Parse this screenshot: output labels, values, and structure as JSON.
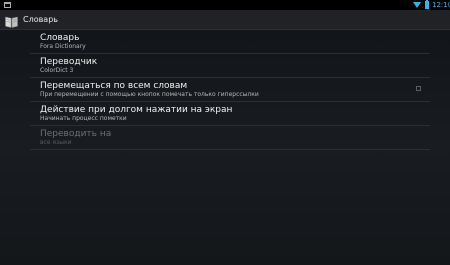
{
  "status_bar": {
    "time": "12:10",
    "notification_icon": "screenshot-notification-icon",
    "wifi_icon": "wifi-icon",
    "battery_icon": "battery-icon",
    "accent_color": "#33b5e5"
  },
  "action_bar": {
    "title": "Словарь",
    "icon": "book-icon"
  },
  "preferences": [
    {
      "title": "Словарь",
      "summary": "Fora Dictionary",
      "enabled": true,
      "has_checkbox": false
    },
    {
      "title": "Переводчик",
      "summary": "ColorDict 3",
      "enabled": true,
      "has_checkbox": false
    },
    {
      "title": "Перемещаться по всем словам",
      "summary": "При перемещении с помощью кнопок помечать только гиперссылки",
      "enabled": true,
      "has_checkbox": true,
      "checked": false
    },
    {
      "title": "Действие при долгом нажатии на экран",
      "summary": "Начинать процесс пометки",
      "enabled": true,
      "has_checkbox": false
    },
    {
      "title": "Переводить на",
      "summary": "все языки",
      "enabled": false,
      "has_checkbox": false
    }
  ]
}
